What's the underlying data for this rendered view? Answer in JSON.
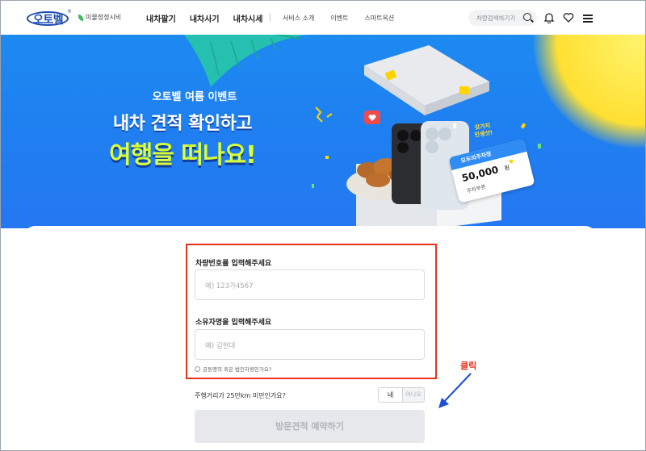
{
  "header": {
    "logo_text": "오토벨",
    "logo_reg": "®",
    "certification": "미물정정시비",
    "nav_main": [
      "내차팔기",
      "내차사기",
      "내차시세"
    ],
    "nav_sub": [
      "서비스 소개",
      "이벤트",
      "스마트옥션"
    ],
    "search_placeholder": "차량검색하기기"
  },
  "banner": {
    "event_small": "오토벨 여름 이벤트",
    "title_line1": "내차 견적 확인하고",
    "title_line2": "여행을 떠나요!",
    "phone_tag_line1": "갖가지",
    "phone_tag_line2": "인생샷!",
    "coupon_title": "모두의주차장",
    "coupon_amount": "50,000",
    "coupon_unit": "원",
    "coupon_sub": "주차쿠폰",
    "colors": {
      "title_highlight": "#d8ff3a",
      "banner_blue": "#1f7ff0"
    }
  },
  "form": {
    "plate_label": "차량번호를 입력해주세요",
    "plate_placeholder": "예) 123가4567",
    "owner_label": "소유자명을 입력해주세요",
    "owner_placeholder": "예) 김현대",
    "joint_owner_text": "공동명의 혹은 법인차량인가요?",
    "distance_question": "주행거리가 25만km 미만인가요?",
    "toggle_yes": "네",
    "toggle_no": "아니오",
    "submit_label": "방문견적 예약하기"
  },
  "annotation": {
    "click_label": "클릭",
    "color": "#e8321a"
  }
}
